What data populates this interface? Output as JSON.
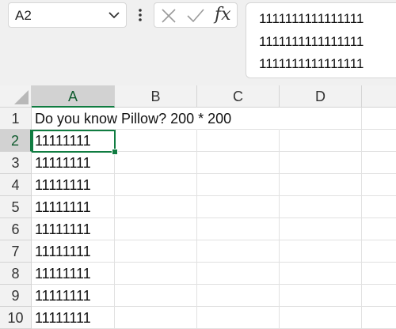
{
  "name_box": {
    "value": "A2"
  },
  "formula_bar": {
    "fx_label": "fx",
    "content_lines": [
      "1111111111111111",
      "1111111111111111",
      "1111111111111111"
    ]
  },
  "sheet": {
    "columns": [
      "A",
      "B",
      "C",
      "D"
    ],
    "rows": [
      {
        "label": "1",
        "a": "Do you know Pillow? 200 * 200"
      },
      {
        "label": "2",
        "a": "11111111"
      },
      {
        "label": "3",
        "a": "11111111"
      },
      {
        "label": "4",
        "a": "11111111"
      },
      {
        "label": "5",
        "a": "11111111"
      },
      {
        "label": "6",
        "a": "11111111"
      },
      {
        "label": "7",
        "a": "11111111"
      },
      {
        "label": "8",
        "a": "11111111"
      },
      {
        "label": "9",
        "a": "11111111"
      },
      {
        "label": "10",
        "a": "11111111"
      }
    ]
  },
  "colors": {
    "accent": "#107c41"
  }
}
